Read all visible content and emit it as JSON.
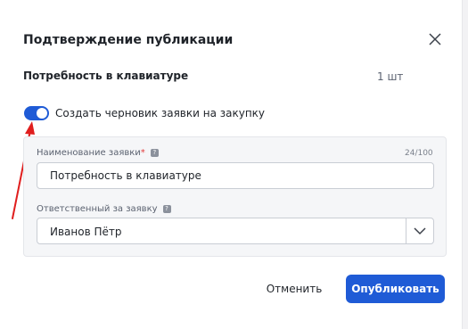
{
  "dialog": {
    "title": "Подтверждение публикации",
    "close_icon": "close-icon"
  },
  "need": {
    "label": "Потребность в клавиатуре",
    "quantity": "1 шт"
  },
  "draft_toggle": {
    "label": "Создать черновик заявки на закупку",
    "on": true
  },
  "form": {
    "name_label": "Наименование заявки",
    "name_required_mark": "*",
    "name_counter": "24/100",
    "name_value": "Потребность в клавиатуре",
    "owner_label": "Ответственный за заявку",
    "owner_value": "Иванов Пётр",
    "help_glyph": "?"
  },
  "buttons": {
    "cancel": "Отменить",
    "publish": "Опубликовать"
  },
  "annotation": {
    "arrow_icon": "red-arrow-icon",
    "arrow_color": "#e01e1e"
  },
  "colors": {
    "accent": "#1f5bd6"
  }
}
